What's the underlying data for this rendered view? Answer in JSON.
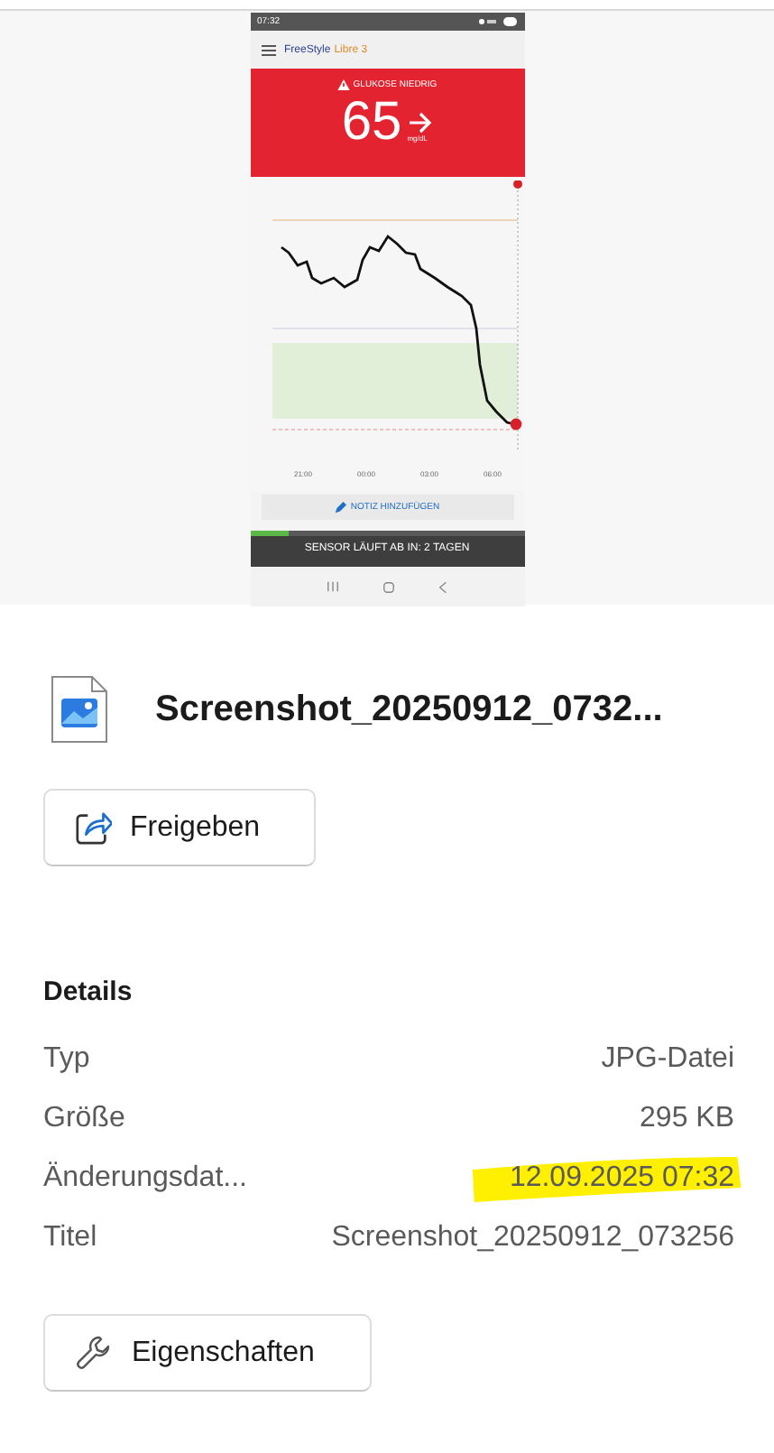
{
  "preview": {
    "status_time": "07:32",
    "app_brand": "FreeStyle",
    "app_model": "Libre 3",
    "alert": "GLUKOSE NIEDRIG",
    "reading": "65",
    "unit": "mg/dL",
    "x_labels": [
      "21:00",
      "00:00",
      "03:00",
      "06:00"
    ],
    "note_button": "NOTIZ HINZUFÜGEN",
    "sensor": {
      "text": "SENSOR LÄUFT AB IN: 2 TAGEN",
      "level": 0.14
    }
  },
  "file": {
    "name": "Screenshot_20250912_0732..."
  },
  "share_button": "Freigeben",
  "details": {
    "heading": "Details",
    "rows": [
      {
        "label": "Typ",
        "value": "JPG-Datei",
        "highlighted": false
      },
      {
        "label": "Größe",
        "value": "295 KB",
        "highlighted": false
      },
      {
        "label": "Änderungsdat...",
        "value": "12.09.2025 07:32",
        "highlighted": true
      },
      {
        "label": "Titel",
        "value": "Screenshot_20250912_073256",
        "highlighted": false
      }
    ]
  },
  "properties_button": "Eigenschaften"
}
